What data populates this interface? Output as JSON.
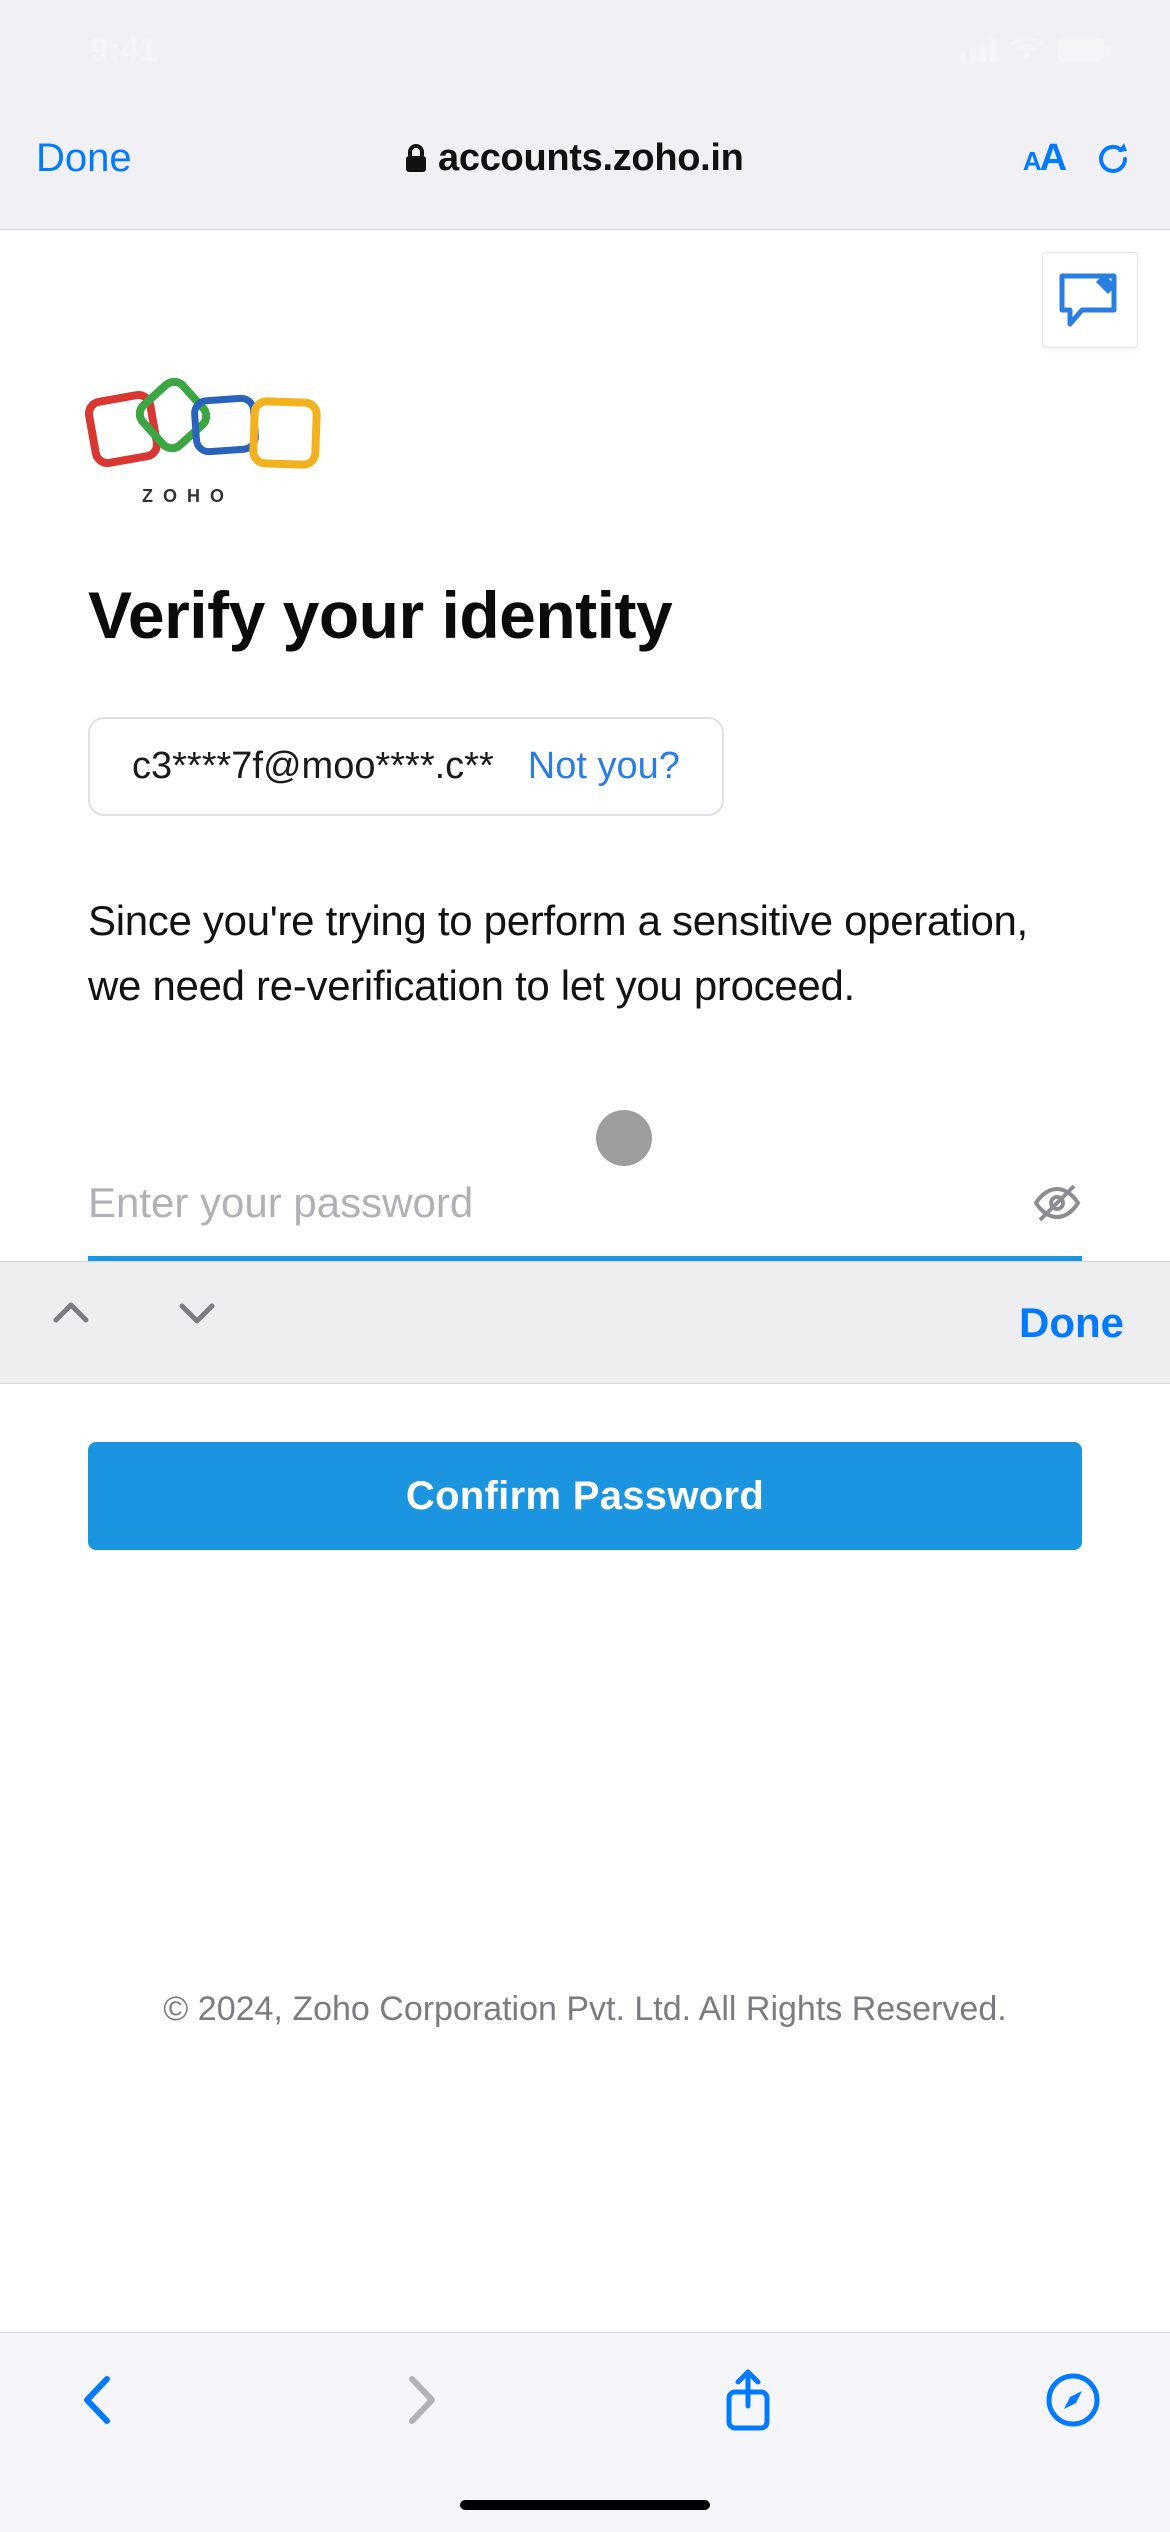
{
  "status_bar": {
    "time": "9:41"
  },
  "safari": {
    "done_label": "Done",
    "url": "accounts.zoho.in"
  },
  "logo": {
    "brand": "ZOHO"
  },
  "page": {
    "title": "Verify your identity",
    "email_masked": "c3****7f@moo****.c**",
    "not_you_label": "Not you?",
    "explain": "Since you're trying to perform a sensitive operation, we need re-verification to let you proceed.",
    "password_placeholder": "Enter your password",
    "confirm_btn_label": "Confirm Password",
    "copyright": "© 2024, Zoho Corporation Pvt. Ltd. All Rights Reserved."
  },
  "keyboard": {
    "done_label": "Done"
  },
  "colors": {
    "accent": "#1b95e0",
    "ios_link": "#007aff"
  }
}
